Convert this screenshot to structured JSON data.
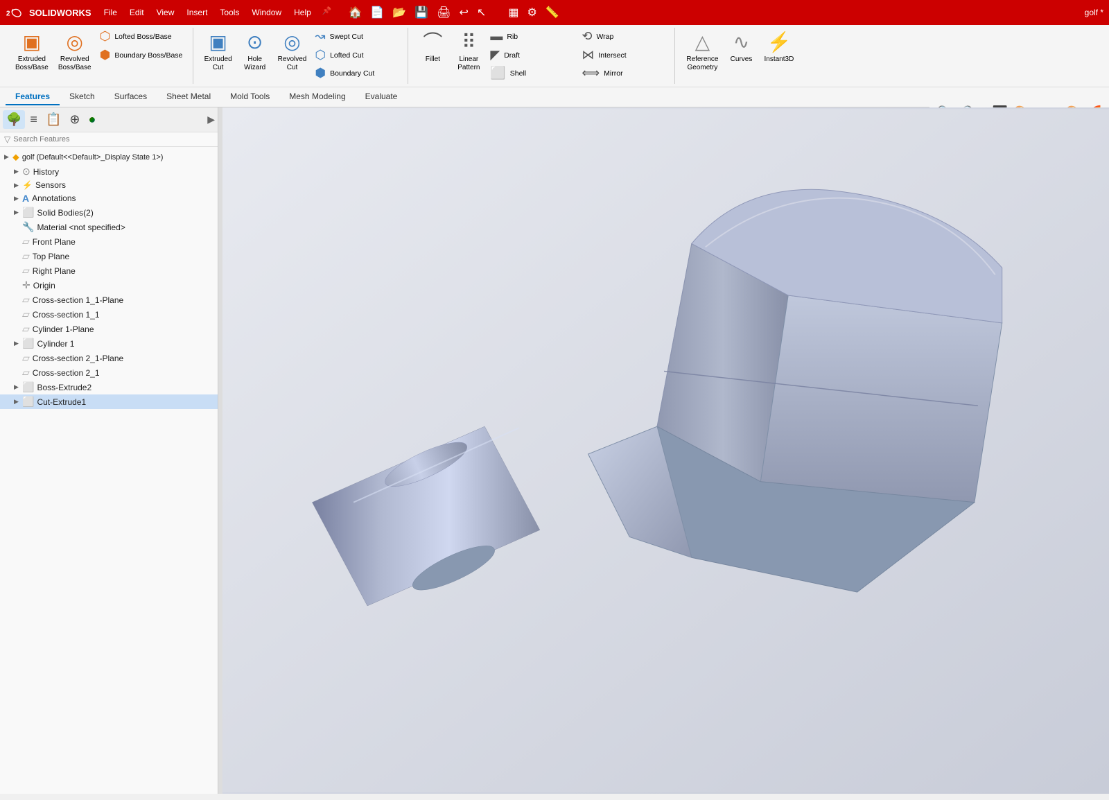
{
  "titlebar": {
    "logo_text": "SOLIDWORKS",
    "menu_items": [
      "File",
      "Edit",
      "View",
      "Insert",
      "Tools",
      "Window",
      "Help"
    ],
    "title": "golf *"
  },
  "ribbon": {
    "groups": [
      {
        "name": "extrude-group",
        "items": [
          {
            "id": "extruded-boss",
            "label": "Extruded\nBoss/Base",
            "icon": "▣"
          },
          {
            "id": "revolved-boss",
            "label": "Revolved\nBoss/Base",
            "icon": "◎"
          },
          {
            "id": "lofted-boss",
            "label": "Lofted Boss/Base",
            "icon": "⬡"
          },
          {
            "id": "boundary-boss",
            "label": "Boundary Boss/Base",
            "icon": "⬢"
          }
        ]
      },
      {
        "name": "cut-group",
        "items": [
          {
            "id": "extruded-cut",
            "label": "Extruded\nCut",
            "icon": "▣"
          },
          {
            "id": "hole-wizard",
            "label": "Hole\nWizard",
            "icon": "⊙"
          },
          {
            "id": "revolved-cut",
            "label": "Revolved\nCut",
            "icon": "◎"
          },
          {
            "id": "swept-cut",
            "label": "Swept Cut",
            "icon": "↝"
          },
          {
            "id": "lofted-cut",
            "label": "Lofted Cut",
            "icon": "⬡"
          },
          {
            "id": "boundary-cut",
            "label": "Boundary Cut",
            "icon": "⬢"
          }
        ]
      },
      {
        "name": "feature-group",
        "items": [
          {
            "id": "fillet",
            "label": "Fillet",
            "icon": "⌒"
          },
          {
            "id": "linear-pattern",
            "label": "Linear\nPattern",
            "icon": "⠿"
          },
          {
            "id": "rib",
            "label": "Rib",
            "icon": "▬"
          },
          {
            "id": "draft",
            "label": "Draft",
            "icon": "◤"
          },
          {
            "id": "shell",
            "label": "Shell",
            "icon": "⬜"
          },
          {
            "id": "wrap",
            "label": "Wrap",
            "icon": "⟲"
          },
          {
            "id": "intersect",
            "label": "Intersect",
            "icon": "⋈"
          },
          {
            "id": "mirror",
            "label": "Mirror",
            "icon": "⟺"
          }
        ]
      },
      {
        "name": "ref-group",
        "items": [
          {
            "id": "reference-geometry",
            "label": "Reference\nGeometry",
            "icon": "△"
          },
          {
            "id": "curves",
            "label": "Curves",
            "icon": "∿"
          },
          {
            "id": "instant3d",
            "label": "Instant3D",
            "icon": "⚡"
          }
        ]
      }
    ],
    "tabs": [
      "Features",
      "Sketch",
      "Surfaces",
      "Sheet Metal",
      "Mold Tools",
      "Mesh Modeling",
      "Evaluate"
    ],
    "active_tab": "Features"
  },
  "sidebar": {
    "tools": [
      {
        "id": "feature-manager",
        "icon": "🌳",
        "tooltip": "FeatureManager"
      },
      {
        "id": "property-manager",
        "icon": "≡",
        "tooltip": "PropertyManager"
      },
      {
        "id": "config-manager",
        "icon": "📋",
        "tooltip": "ConfigurationManager"
      },
      {
        "id": "dimension-manager",
        "icon": "⊕",
        "tooltip": "DimensionXpertManager"
      },
      {
        "id": "display-manager",
        "icon": "🎨",
        "tooltip": "DisplayManager"
      }
    ],
    "filter_placeholder": "Search Features",
    "tree": [
      {
        "id": "root",
        "label": "golf  (Default<<Default>_Display State 1>)",
        "icon": "🔶",
        "expand": "▶",
        "indent": 0,
        "selected": false
      },
      {
        "id": "history",
        "label": "History",
        "icon": "⊙",
        "expand": "▶",
        "indent": 1,
        "selected": false
      },
      {
        "id": "sensors",
        "label": "Sensors",
        "icon": "📡",
        "expand": "▶",
        "indent": 1,
        "selected": false
      },
      {
        "id": "annotations",
        "label": "Annotations",
        "icon": "A",
        "expand": "▶",
        "indent": 1,
        "selected": false
      },
      {
        "id": "solid-bodies",
        "label": "Solid Bodies(2)",
        "icon": "◼",
        "expand": "▶",
        "indent": 1,
        "selected": false
      },
      {
        "id": "material",
        "label": "Material <not specified>",
        "icon": "🔧",
        "expand": "",
        "indent": 1,
        "selected": false
      },
      {
        "id": "front-plane",
        "label": "Front Plane",
        "icon": "▱",
        "expand": "",
        "indent": 1,
        "selected": false
      },
      {
        "id": "top-plane",
        "label": "Top Plane",
        "icon": "▱",
        "expand": "",
        "indent": 1,
        "selected": false
      },
      {
        "id": "right-plane",
        "label": "Right Plane",
        "icon": "▱",
        "expand": "",
        "indent": 1,
        "selected": false
      },
      {
        "id": "origin",
        "label": "Origin",
        "icon": "✛",
        "expand": "",
        "indent": 1,
        "selected": false
      },
      {
        "id": "cross-section-1-1-plane",
        "label": "Cross-section 1_1-Plane",
        "icon": "▱",
        "expand": "",
        "indent": 1,
        "selected": false
      },
      {
        "id": "cross-section-1-1",
        "label": "Cross-section 1_1",
        "icon": "▱",
        "expand": "",
        "indent": 1,
        "selected": false
      },
      {
        "id": "cylinder-1-plane",
        "label": "Cylinder 1-Plane",
        "icon": "▱",
        "expand": "",
        "indent": 1,
        "selected": false
      },
      {
        "id": "cylinder-1",
        "label": "Cylinder 1",
        "icon": "◼",
        "expand": "▶",
        "indent": 1,
        "selected": false
      },
      {
        "id": "cross-section-2-1-plane",
        "label": "Cross-section 2_1-Plane",
        "icon": "▱",
        "expand": "",
        "indent": 1,
        "selected": false
      },
      {
        "id": "cross-section-2-1",
        "label": "Cross-section 2_1",
        "icon": "▱",
        "expand": "",
        "indent": 1,
        "selected": false
      },
      {
        "id": "boss-extrude2",
        "label": "Boss-Extrude2",
        "icon": "◼",
        "expand": "▶",
        "indent": 1,
        "selected": false
      },
      {
        "id": "cut-extrude1",
        "label": "Cut-Extrude1",
        "icon": "◼",
        "expand": "▶",
        "indent": 1,
        "selected": true
      }
    ]
  },
  "viewport": {
    "background_start": "#e8eaf0",
    "background_end": "#c8ccd8"
  }
}
